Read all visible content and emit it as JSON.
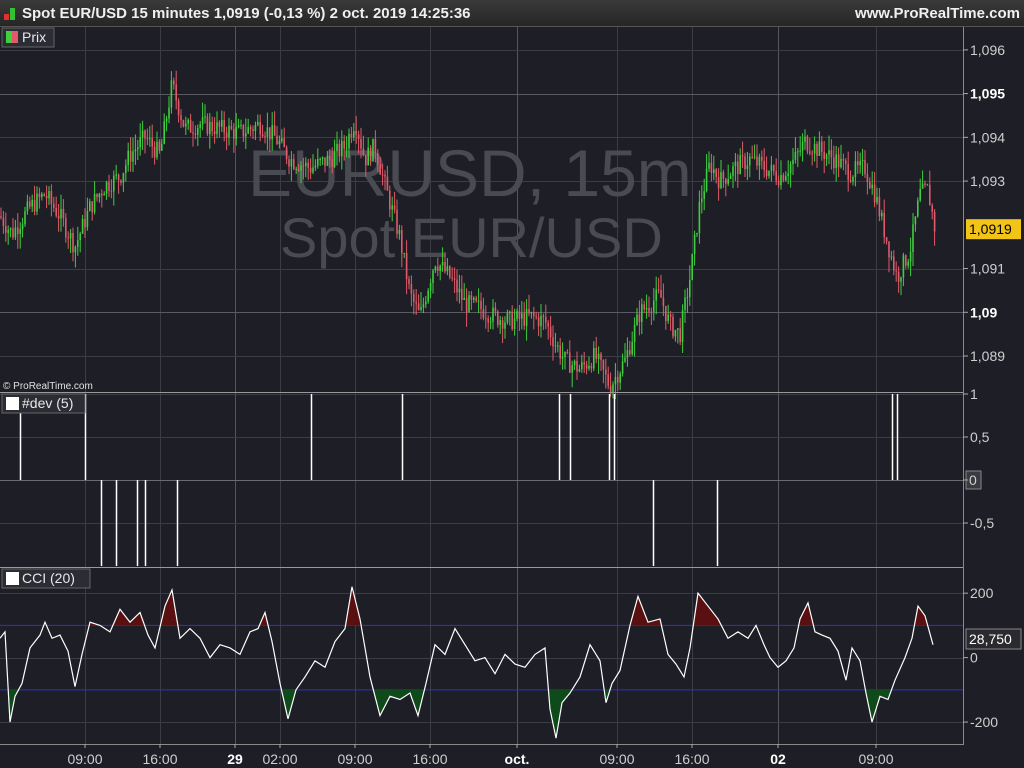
{
  "window": {
    "title": "Spot EUR/USD 15 minutes 1,0919 (-0,13 %) 2 oct. 2019 14:25:36",
    "site": "www.ProRealTime.com"
  },
  "colors": {
    "background": "#1e1e26",
    "bull": "#3ecf3e",
    "bear": "#e05a6a",
    "cci_line": "#ffffff",
    "cci_band": "#3030c8",
    "price_badge": "#f2c418",
    "overbought_fill": "#5a1010",
    "oversold_fill": "#0f4a1a"
  },
  "chart_data": [
    {
      "type": "candlestick",
      "legend": "Prix",
      "watermark_line1": "EURUSD, 15m",
      "watermark_line2": "Spot EUR/USD",
      "copyright": "© ProRealTime.com",
      "ylim": [
        1.0882,
        1.0965
      ],
      "y_ticks": [
        "1,096",
        "1,095",
        "1,094",
        "1,093",
        "1,091",
        "1,09",
        "1,089"
      ],
      "y_ticks_bold": [
        "1,095",
        "1,09"
      ],
      "last_price_label": "1,0919",
      "last_price": 1.0919,
      "close_path": [
        [
          0,
          1.0922
        ],
        [
          12,
          1.0918
        ],
        [
          30,
          1.0924
        ],
        [
          45,
          1.0927
        ],
        [
          60,
          1.0922
        ],
        [
          75,
          1.0915
        ],
        [
          90,
          1.0924
        ],
        [
          105,
          1.0929
        ],
        [
          120,
          1.0931
        ],
        [
          130,
          1.0936
        ],
        [
          145,
          1.094
        ],
        [
          160,
          1.0936
        ],
        [
          172,
          1.0952
        ],
        [
          185,
          1.0942
        ],
        [
          200,
          1.0943
        ],
        [
          220,
          1.0942
        ],
        [
          240,
          1.0941
        ],
        [
          260,
          1.0943
        ],
        [
          275,
          1.094
        ],
        [
          290,
          1.0935
        ],
        [
          310,
          1.0933
        ],
        [
          330,
          1.0935
        ],
        [
          345,
          1.0938
        ],
        [
          355,
          1.0944
        ],
        [
          365,
          1.0935
        ],
        [
          375,
          1.0938
        ],
        [
          385,
          1.0929
        ],
        [
          400,
          1.0917
        ],
        [
          410,
          1.0904
        ],
        [
          420,
          1.0899
        ],
        [
          435,
          1.0912
        ],
        [
          450,
          1.0908
        ],
        [
          465,
          1.0902
        ],
        [
          480,
          1.0901
        ],
        [
          495,
          1.0899
        ],
        [
          510,
          1.0898
        ],
        [
          530,
          1.0899
        ],
        [
          545,
          1.0898
        ],
        [
          555,
          1.0893
        ],
        [
          565,
          1.0889
        ],
        [
          580,
          1.0887
        ],
        [
          595,
          1.089
        ],
        [
          610,
          1.0883
        ],
        [
          625,
          1.0889
        ],
        [
          640,
          1.09
        ],
        [
          660,
          1.0904
        ],
        [
          670,
          1.0897
        ],
        [
          680,
          1.0895
        ],
        [
          690,
          1.0908
        ],
        [
          700,
          1.0925
        ],
        [
          710,
          1.0934
        ],
        [
          720,
          1.093
        ],
        [
          735,
          1.0933
        ],
        [
          750,
          1.0935
        ],
        [
          765,
          1.0933
        ],
        [
          780,
          1.0931
        ],
        [
          795,
          1.0935
        ],
        [
          805,
          1.0939
        ],
        [
          820,
          1.0937
        ],
        [
          835,
          1.0935
        ],
        [
          850,
          1.0932
        ],
        [
          865,
          1.0933
        ],
        [
          875,
          1.0927
        ],
        [
          885,
          1.0918
        ],
        [
          897,
          1.0908
        ],
        [
          910,
          1.0914
        ],
        [
          920,
          1.0927
        ],
        [
          928,
          1.0928
        ],
        [
          935,
          1.0919
        ]
      ]
    },
    {
      "type": "bar",
      "legend": "#dev (5)",
      "ylim": [
        -1,
        1
      ],
      "y_ticks": [
        "1",
        "0,5",
        "0",
        "-0,5"
      ],
      "positive_x": [
        20,
        85,
        311,
        402,
        559,
        570,
        609,
        614,
        892,
        897
      ],
      "negative_x": [
        101,
        116,
        137,
        145,
        177,
        653,
        717
      ]
    },
    {
      "type": "line",
      "legend": "CCI (20)",
      "ylim": [
        -265,
        275
      ],
      "y_ticks": [
        "200",
        "0",
        "-200"
      ],
      "bands": [
        100,
        -100
      ],
      "last_value_label": "28,750",
      "path": [
        [
          0,
          60
        ],
        [
          5,
          80
        ],
        [
          10,
          -200
        ],
        [
          15,
          -120
        ],
        [
          22,
          -80
        ],
        [
          30,
          30
        ],
        [
          40,
          70
        ],
        [
          45,
          110
        ],
        [
          52,
          60
        ],
        [
          60,
          70
        ],
        [
          68,
          20
        ],
        [
          75,
          -90
        ],
        [
          82,
          10
        ],
        [
          90,
          110
        ],
        [
          100,
          100
        ],
        [
          110,
          80
        ],
        [
          120,
          150
        ],
        [
          130,
          110
        ],
        [
          140,
          140
        ],
        [
          148,
          70
        ],
        [
          155,
          30
        ],
        [
          165,
          160
        ],
        [
          172,
          210
        ],
        [
          180,
          60
        ],
        [
          190,
          90
        ],
        [
          200,
          60
        ],
        [
          210,
          0
        ],
        [
          220,
          40
        ],
        [
          230,
          30
        ],
        [
          240,
          10
        ],
        [
          250,
          80
        ],
        [
          258,
          90
        ],
        [
          265,
          140
        ],
        [
          272,
          50
        ],
        [
          280,
          -80
        ],
        [
          288,
          -190
        ],
        [
          296,
          -100
        ],
        [
          305,
          -60
        ],
        [
          315,
          -10
        ],
        [
          325,
          -30
        ],
        [
          335,
          50
        ],
        [
          345,
          90
        ],
        [
          352,
          220
        ],
        [
          360,
          120
        ],
        [
          365,
          30
        ],
        [
          370,
          -60
        ],
        [
          380,
          -180
        ],
        [
          390,
          -120
        ],
        [
          400,
          -130
        ],
        [
          410,
          -110
        ],
        [
          418,
          -180
        ],
        [
          426,
          -80
        ],
        [
          435,
          40
        ],
        [
          445,
          10
        ],
        [
          455,
          90
        ],
        [
          465,
          40
        ],
        [
          475,
          -10
        ],
        [
          485,
          0
        ],
        [
          495,
          -50
        ],
        [
          505,
          10
        ],
        [
          515,
          -20
        ],
        [
          525,
          -30
        ],
        [
          535,
          10
        ],
        [
          545,
          30
        ],
        [
          550,
          -160
        ],
        [
          556,
          -250
        ],
        [
          562,
          -140
        ],
        [
          570,
          -110
        ],
        [
          580,
          -60
        ],
        [
          590,
          40
        ],
        [
          600,
          -10
        ],
        [
          606,
          -140
        ],
        [
          612,
          -80
        ],
        [
          620,
          -40
        ],
        [
          630,
          100
        ],
        [
          638,
          190
        ],
        [
          648,
          110
        ],
        [
          660,
          120
        ],
        [
          668,
          10
        ],
        [
          676,
          -20
        ],
        [
          684,
          -60
        ],
        [
          690,
          30
        ],
        [
          698,
          200
        ],
        [
          708,
          160
        ],
        [
          718,
          120
        ],
        [
          728,
          60
        ],
        [
          738,
          80
        ],
        [
          748,
          60
        ],
        [
          756,
          100
        ],
        [
          764,
          40
        ],
        [
          770,
          0
        ],
        [
          778,
          -30
        ],
        [
          786,
          -10
        ],
        [
          794,
          30
        ],
        [
          800,
          120
        ],
        [
          808,
          170
        ],
        [
          815,
          80
        ],
        [
          822,
          70
        ],
        [
          830,
          60
        ],
        [
          838,
          20
        ],
        [
          846,
          -70
        ],
        [
          852,
          30
        ],
        [
          860,
          -10
        ],
        [
          866,
          -110
        ],
        [
          872,
          -200
        ],
        [
          880,
          -120
        ],
        [
          888,
          -130
        ],
        [
          895,
          -70
        ],
        [
          905,
          0
        ],
        [
          912,
          60
        ],
        [
          918,
          160
        ],
        [
          925,
          130
        ],
        [
          933,
          40
        ]
      ]
    }
  ],
  "x_axis": {
    "labels": [
      {
        "text": "09:00",
        "bold": false
      },
      {
        "text": "16:00",
        "bold": false
      },
      {
        "text": "29",
        "bold": true
      },
      {
        "text": "02:00",
        "bold": false
      },
      {
        "text": "09:00",
        "bold": false
      },
      {
        "text": "16:00",
        "bold": false
      },
      {
        "text": "oct.",
        "bold": true
      },
      {
        "text": "09:00",
        "bold": false
      },
      {
        "text": "16:00",
        "bold": false
      },
      {
        "text": "02",
        "bold": true
      },
      {
        "text": "09:00",
        "bold": false
      }
    ]
  }
}
